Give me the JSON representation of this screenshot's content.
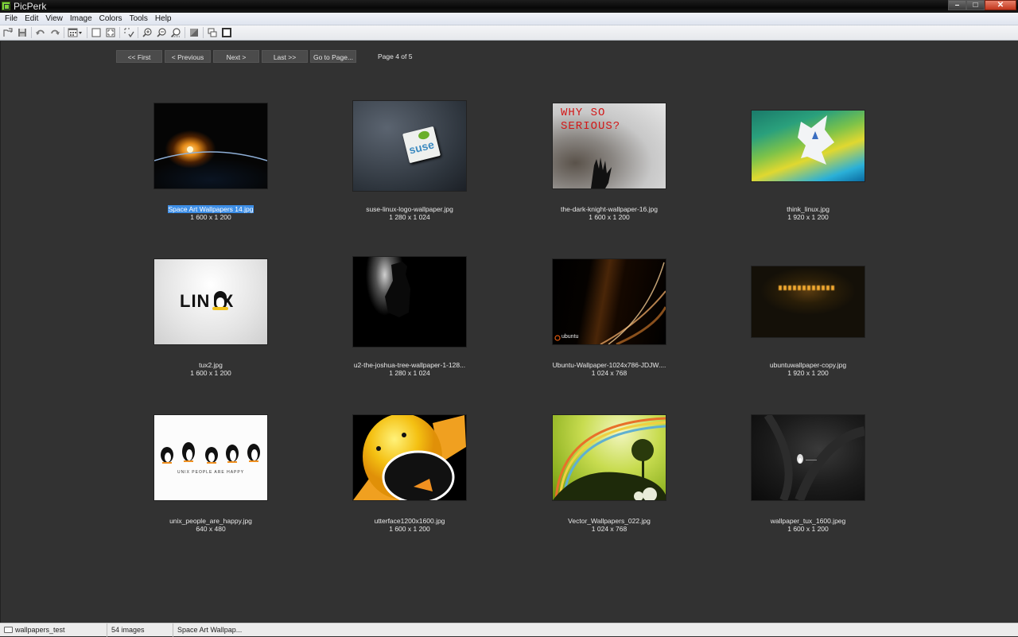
{
  "window": {
    "title": "PicPerk",
    "controls": {
      "minimize": "–",
      "maximize": "□",
      "close": "✕"
    }
  },
  "menubar": {
    "items": [
      "File",
      "Edit",
      "View",
      "Image",
      "Colors",
      "Tools",
      "Help"
    ]
  },
  "toolbar": {
    "icons": [
      "open-icon",
      "save-icon",
      "undo-icon",
      "redo-icon",
      "view-mode-dropdown-icon",
      "select-rect-icon",
      "fit-icon",
      "select-tool-icon",
      "zoom-in-icon",
      "zoom-out-icon",
      "zoom-fit-icon",
      "adjust-icon",
      "compare-icon",
      "fullscreen-icon"
    ]
  },
  "pager": {
    "first": "<< First",
    "previous": "< Previous",
    "next": "Next >",
    "last": "Last >>",
    "goto": "Go to Page...",
    "page_info": "Page 4 of 5"
  },
  "thumbnails": [
    {
      "name": "Space Art Wallpapers 14.jpg",
      "dims": "1 600 x 1 200",
      "selected": true,
      "theme": "space"
    },
    {
      "name": "suse-linux-logo-wallpaper.jpg",
      "dims": "1 280 x 1 024",
      "selected": false,
      "theme": "suse"
    },
    {
      "name": "the-dark-knight-wallpaper-16.jpg",
      "dims": "1 600 x 1 200",
      "selected": false,
      "theme": "joker"
    },
    {
      "name": "think_linux.jpg",
      "dims": "1 920 x 1 200",
      "selected": false,
      "theme": "think"
    },
    {
      "name": "tux2.jpg",
      "dims": "1 600 x 1 200",
      "selected": false,
      "theme": "tux"
    },
    {
      "name": "u2-the-joshua-tree-wallpaper-1-128...",
      "dims": "1 280 x 1 024",
      "selected": false,
      "theme": "u2"
    },
    {
      "name": "Ubuntu-Wallpaper-1024x786-JDJW....",
      "dims": "1 024 x 768",
      "selected": false,
      "theme": "ubuntu"
    },
    {
      "name": "ubuntuwallpaper-copy.jpg",
      "dims": "1 920 x 1 200",
      "selected": false,
      "theme": "ubuntu2"
    },
    {
      "name": "unix_people_are_happy.jpg",
      "dims": "640 x 480",
      "selected": false,
      "theme": "penguins"
    },
    {
      "name": "utterface1200x1600.jpg",
      "dims": "1 600 x 1 200",
      "selected": false,
      "theme": "utter"
    },
    {
      "name": "Vector_Wallpapers_022.jpg",
      "dims": "1 024 x 768",
      "selected": false,
      "theme": "vector"
    },
    {
      "name": "wallpaper_tux_1600.jpeg",
      "dims": "1 600 x 1 200",
      "selected": false,
      "theme": "tuxdark"
    }
  ],
  "thumb_texts": {
    "ubuntu_logo": "ubuntu",
    "linux_word": "LIN  X",
    "joker_text": "WHY SO SERIOUS?",
    "suse_text": "suse",
    "penguins_text": "UNIX PEOPLE ARE HAPPY"
  },
  "statusbar": {
    "folder": "wallpapers_test",
    "count": "54 images",
    "selected": "Space Art Wallpap..."
  }
}
